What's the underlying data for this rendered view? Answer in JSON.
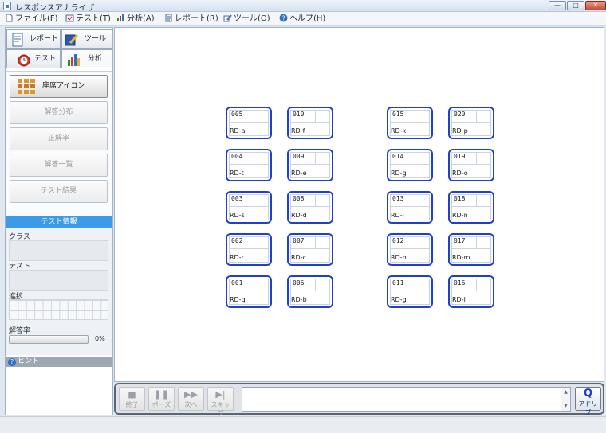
{
  "window": {
    "title": "レスポンスアナライザ",
    "btn_min": "—",
    "btn_max": "□",
    "btn_close": "✕"
  },
  "menu": [
    {
      "label": "ファイル(F)",
      "icon": "file-icon"
    },
    {
      "label": "テスト(T)",
      "icon": "test-icon"
    },
    {
      "label": "分析(A)",
      "icon": "chart-icon"
    },
    {
      "label": "レポート(R)",
      "icon": "report-icon"
    },
    {
      "label": "ツール(O)",
      "icon": "tool-icon"
    },
    {
      "label": "ヘルプ(H)",
      "icon": "help-icon"
    }
  ],
  "tabs": {
    "report": "レポート",
    "tool": "ツール",
    "test": "テスト",
    "analysis": "分析"
  },
  "nav": {
    "seat_icon": "座席アイコン",
    "answer_dist": "解答分布",
    "correct_rate": "正解率",
    "answer_list": "解答一覧",
    "test_result": "テスト結果"
  },
  "test_info": {
    "header": "テスト情報",
    "class_label": "クラス",
    "class_value": "",
    "test_label": "テスト",
    "test_value": "",
    "progress_label": "進捗",
    "rate_label": "解答率",
    "rate_percent": "0%",
    "rate_value": 0
  },
  "hint": {
    "label": "ヒント",
    "icon": "?"
  },
  "seats": [
    {
      "num": "005",
      "name": "RD-a"
    },
    {
      "num": "010",
      "name": "RD-f"
    },
    {
      "num": "015",
      "name": "RD-k"
    },
    {
      "num": "020",
      "name": "RD-p"
    },
    {
      "num": "004",
      "name": "RD-t"
    },
    {
      "num": "009",
      "name": "RD-e"
    },
    {
      "num": "014",
      "name": "RD-g"
    },
    {
      "num": "019",
      "name": "RD-o"
    },
    {
      "num": "003",
      "name": "RD-s"
    },
    {
      "num": "008",
      "name": "RD-d"
    },
    {
      "num": "013",
      "name": "RD-i"
    },
    {
      "num": "018",
      "name": "RD-n"
    },
    {
      "num": "002",
      "name": "RD-r"
    },
    {
      "num": "007",
      "name": "RD-c"
    },
    {
      "num": "012",
      "name": "RD-h"
    },
    {
      "num": "017",
      "name": "RD-m"
    },
    {
      "num": "001",
      "name": "RD-q"
    },
    {
      "num": "006",
      "name": "RD-b"
    },
    {
      "num": "011",
      "name": "RD-g"
    },
    {
      "num": "016",
      "name": "RD-l"
    }
  ],
  "controls": {
    "end": {
      "label": "終了",
      "glyph": "■"
    },
    "pause": {
      "label": "ポーズ",
      "glyph": "❚❚"
    },
    "next": {
      "label": "次へ",
      "glyph": "▶▶"
    },
    "skip": {
      "label": "スキップ",
      "glyph": "▶|"
    },
    "message": "",
    "scroll_up": "▲",
    "scroll_down": "▼",
    "adrib": {
      "label": "アドリブ",
      "glyph": "Q"
    }
  }
}
